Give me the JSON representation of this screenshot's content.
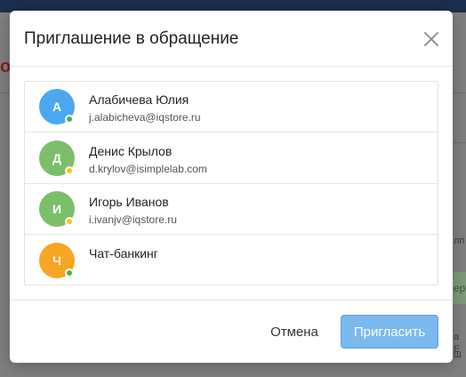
{
  "background": {
    "red_glyph": "о",
    "snippets": [
      "лп",
      "ер",
      "а Е",
      "ш"
    ]
  },
  "dialog": {
    "title": "Приглашение в обращение",
    "close_icon": "close-icon",
    "cancel_label": "Отмена",
    "invite_label": "Пригласить",
    "colors": {
      "invite_bg": "#7ab9ee",
      "online": "#4caf50",
      "away": "#f5c518"
    },
    "participants": [
      {
        "initial": "А",
        "name": "Алабичева Юлия",
        "email": "j.alabicheva@iqstore.ru",
        "avatar_color": "#4aa8f0",
        "status": "online",
        "status_color": "#4caf50"
      },
      {
        "initial": "Д",
        "name": "Денис Крылов",
        "email": "d.krylov@isimplelab.com",
        "avatar_color": "#7bbf6a",
        "status": "away",
        "status_color": "#f5c518"
      },
      {
        "initial": "И",
        "name": "Игорь Иванов",
        "email": "i.ivanjv@iqstore.ru",
        "avatar_color": "#7bbf6a",
        "status": "away",
        "status_color": "#f5c518"
      },
      {
        "initial": "Ч",
        "name": "Чат-банкинг",
        "email": "",
        "avatar_color": "#f6a623",
        "status": "online",
        "status_color": "#4caf50"
      }
    ]
  }
}
